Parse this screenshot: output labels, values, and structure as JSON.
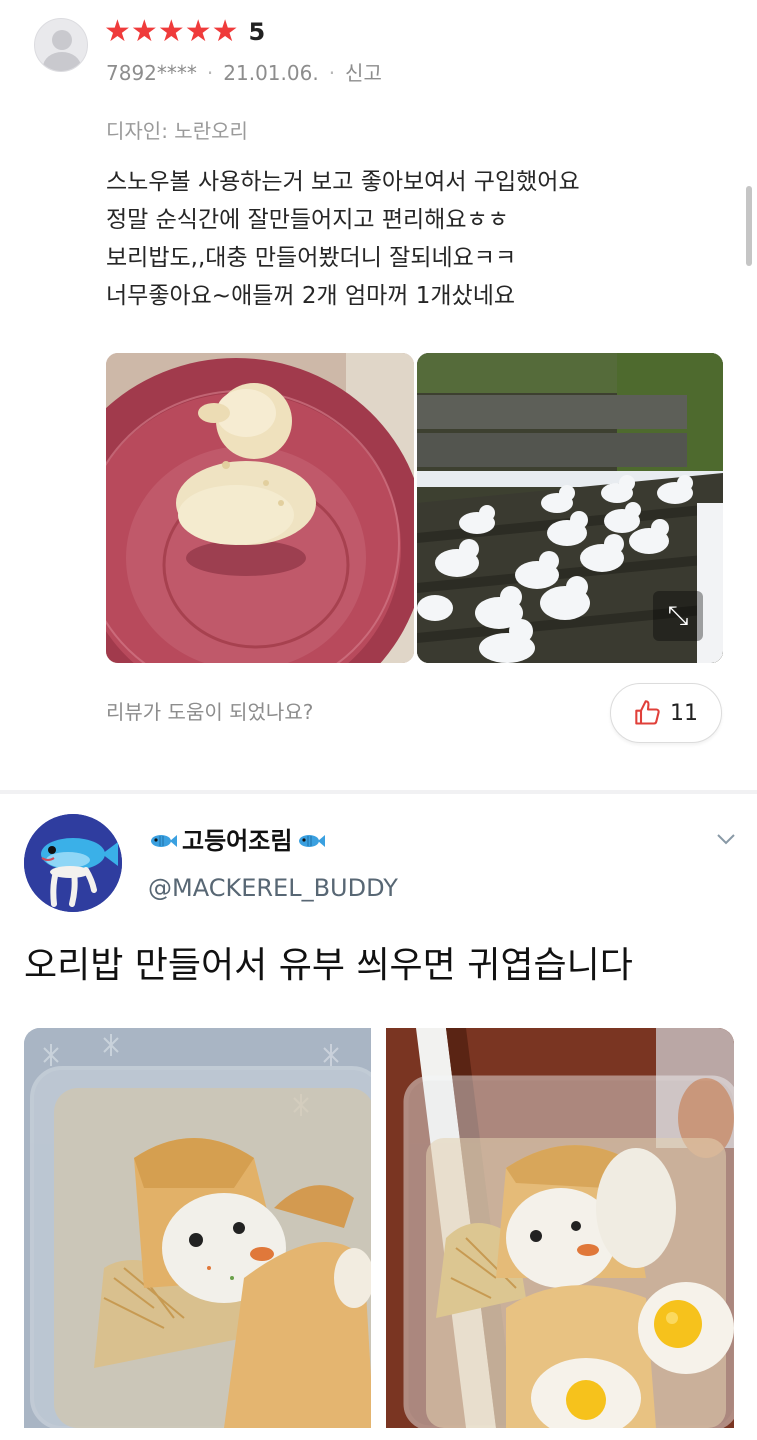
{
  "review": {
    "rating": "5",
    "stars_filled": 5,
    "stars_total": 5,
    "user_id": "7892****",
    "date": "21.01.06.",
    "report_label": "신고",
    "design_option": "디자인: 노란오리",
    "text_lines": [
      "스노우볼 사용하는거 보고 좋아보여서 구입했어요",
      "정말 순식간에 잘만들어지고 편리해요ㅎㅎ",
      "보리밥도,,대충 만들어봤더니 잘되네요ㅋㅋ",
      "너무좋아요~애들꺼 2개 엄마꺼 1개샀네요"
    ],
    "helpful_question": "리뷰가 도움이 되었나요?",
    "like_count": "11",
    "star_color": "#ef3b3b",
    "like_icon_color": "#e0403a"
  },
  "tweet": {
    "display_name": "고등어조림",
    "handle": "@MACKEREL_BUDDY",
    "text": "오리밥 만들어서 유부 씌우면 귀엽습니다",
    "handle_color": "#586774"
  },
  "icons": {
    "avatar": "default-user-avatar",
    "star": "star-icon",
    "like": "thumbs-up-icon",
    "expand": "expand-arrows-icon",
    "chevron": "chevron-down-icon",
    "fish": "fish-emoji-icon"
  }
}
